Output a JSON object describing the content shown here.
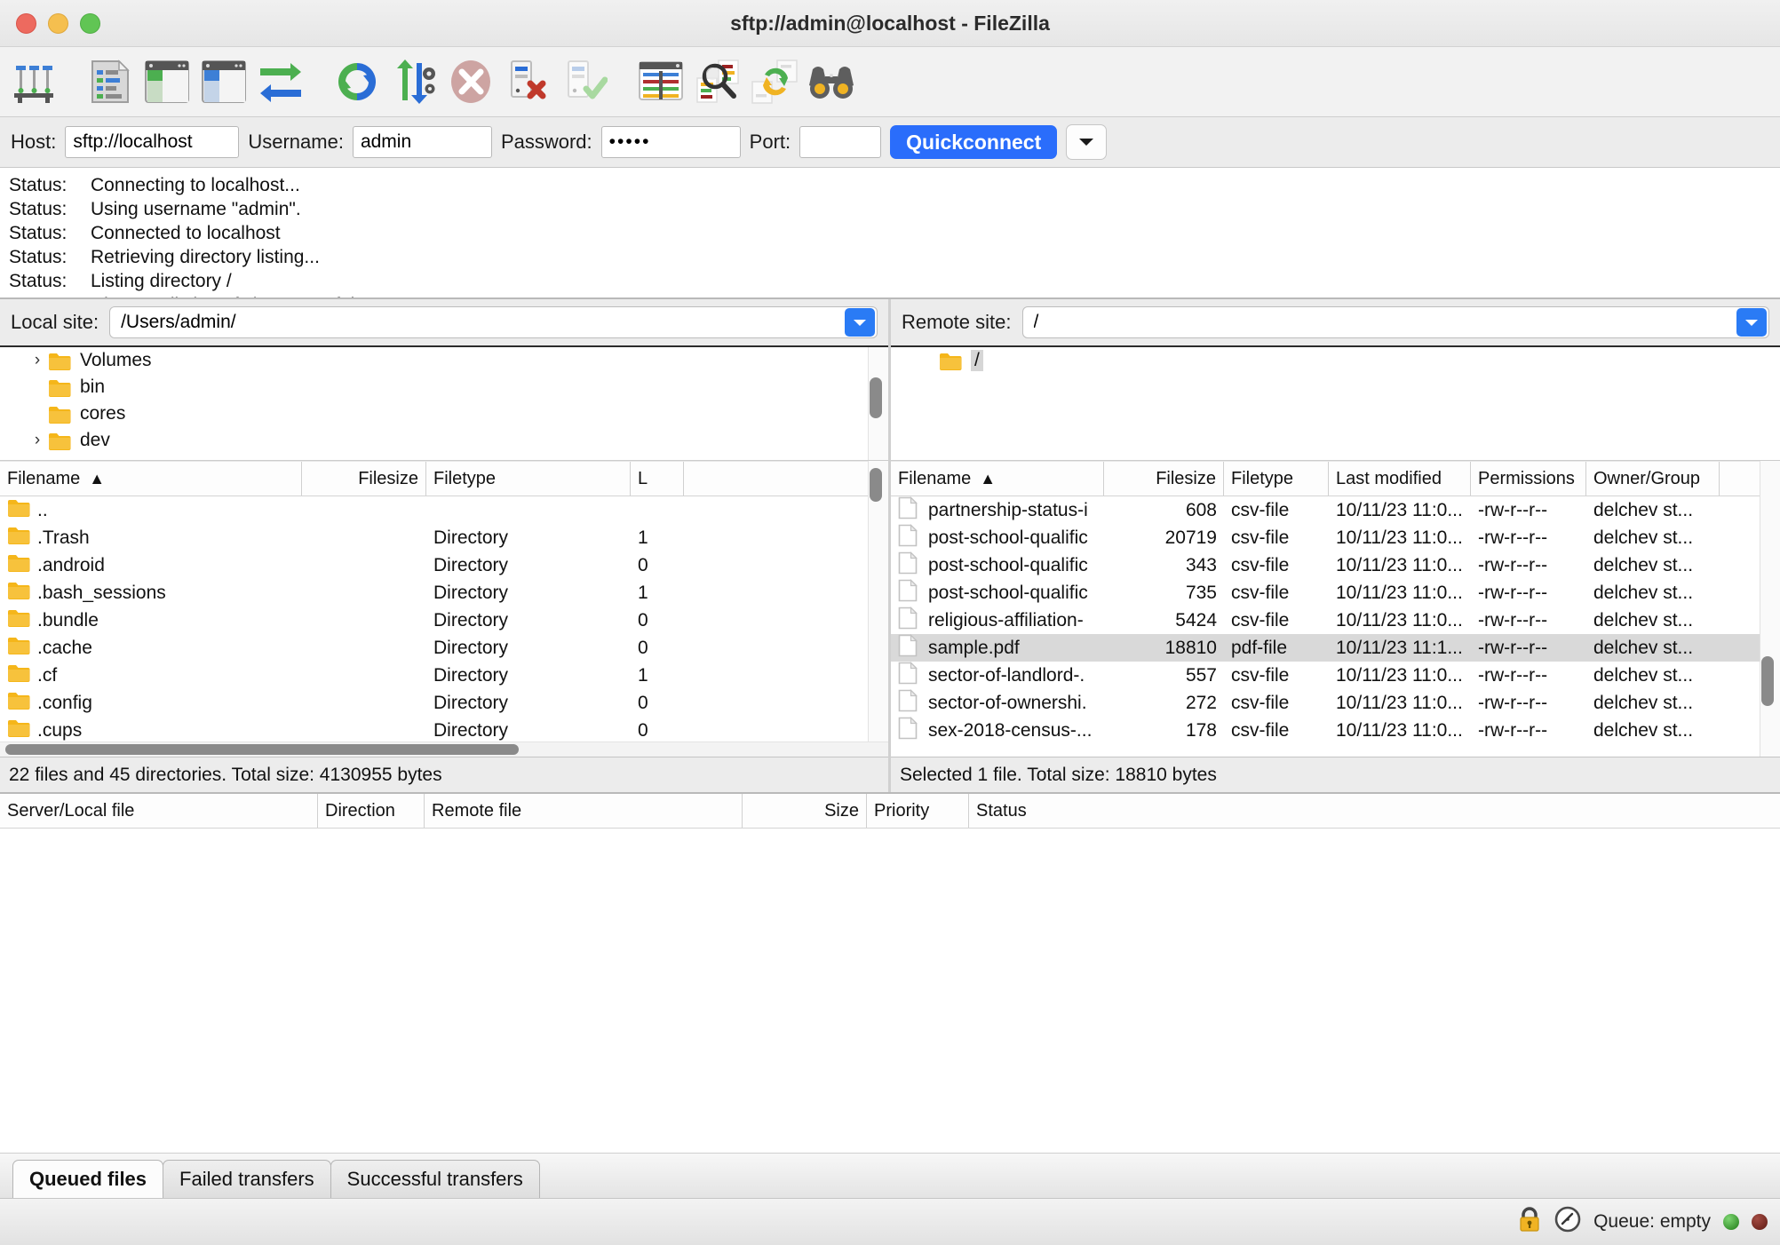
{
  "window": {
    "title": "sftp://admin@localhost - FileZilla",
    "traffic_lights": [
      "close",
      "minimize",
      "maximize"
    ]
  },
  "toolbar": {
    "items": [
      {
        "name": "site-manager-icon",
        "tip": "Open the Site Manager"
      },
      {
        "name": "toggle-message-log-icon",
        "tip": "Toggle message log"
      },
      {
        "name": "toggle-local-tree-icon",
        "tip": "Toggle local directory tree"
      },
      {
        "name": "toggle-remote-tree-icon",
        "tip": "Toggle remote directory tree"
      },
      {
        "name": "toggle-transfer-queue-icon",
        "tip": "Toggle transfer queue"
      },
      {
        "name": "refresh-icon",
        "tip": "Refresh the file and folder lists"
      },
      {
        "name": "process-queue-icon",
        "tip": "Process queue"
      },
      {
        "name": "cancel-icon",
        "tip": "Cancel current operation"
      },
      {
        "name": "disconnect-icon",
        "tip": "Disconnect from server"
      },
      {
        "name": "reconnect-icon",
        "tip": "Reconnect to server"
      },
      {
        "name": "filter-icon",
        "tip": "Open the directory listing filter dialog"
      },
      {
        "name": "compare-directories-icon",
        "tip": "Directory comparison"
      },
      {
        "name": "synchronized-browsing-icon",
        "tip": "Toggle synchronized browsing"
      },
      {
        "name": "find-files-icon",
        "tip": "Search remote files"
      }
    ]
  },
  "quickconnect": {
    "host_label": "Host:",
    "host_value": "sftp://localhost",
    "username_label": "Username:",
    "username_value": "admin",
    "password_label": "Password:",
    "password_value": "•••••",
    "port_label": "Port:",
    "port_value": "",
    "port_placeholder": "",
    "button_label": "Quickconnect",
    "dropdown_icon": "chevron-down-icon",
    "accent_color": "#2a6dfb"
  },
  "log": {
    "entries": [
      {
        "key": "Status:",
        "message": "Connecting to localhost..."
      },
      {
        "key": "Status:",
        "message": "Using username \"admin\"."
      },
      {
        "key": "Status:",
        "message": "Connected to localhost"
      },
      {
        "key": "Status:",
        "message": "Retrieving directory listing..."
      },
      {
        "key": "Status:",
        "message": "Listing directory /"
      },
      {
        "key": "Status:",
        "message": "Directory listing of \"/\" successful"
      }
    ]
  },
  "local": {
    "site_label": "Local site:",
    "site_path": "/Users/admin/",
    "dropdown_icon": "chevron-down-icon",
    "tree": [
      {
        "label": "Volumes",
        "expandable": true,
        "selected": false
      },
      {
        "label": "bin",
        "expandable": false,
        "selected": false
      },
      {
        "label": "cores",
        "expandable": false,
        "selected": false
      },
      {
        "label": "dev",
        "expandable": true,
        "selected": false
      }
    ],
    "columns": [
      {
        "label": "Filename",
        "sorted": true,
        "sort_dir": "asc"
      },
      {
        "label": "Filesize"
      },
      {
        "label": "Filetype"
      },
      {
        "label": "L"
      }
    ],
    "rows": [
      {
        "name": "..",
        "size": "",
        "type": "",
        "last": ""
      },
      {
        "name": ".Trash",
        "size": "",
        "type": "Directory",
        "last": "1"
      },
      {
        "name": ".android",
        "size": "",
        "type": "Directory",
        "last": "0"
      },
      {
        "name": ".bash_sessions",
        "size": "",
        "type": "Directory",
        "last": "1"
      },
      {
        "name": ".bundle",
        "size": "",
        "type": "Directory",
        "last": "0"
      },
      {
        "name": ".cache",
        "size": "",
        "type": "Directory",
        "last": "0"
      },
      {
        "name": ".cf",
        "size": "",
        "type": "Directory",
        "last": "1"
      },
      {
        "name": ".config",
        "size": "",
        "type": "Directory",
        "last": "0"
      },
      {
        "name": ".cups",
        "size": "",
        "type": "Directory",
        "last": "0"
      }
    ],
    "status": "22 files and 45 directories. Total size: 4130955 bytes"
  },
  "remote": {
    "site_label": "Remote site:",
    "site_path": "/",
    "dropdown_icon": "chevron-down-icon",
    "tree": [
      {
        "label": "/",
        "expandable": false,
        "selected": true
      }
    ],
    "columns": [
      {
        "label": "Filename",
        "sorted": true,
        "sort_dir": "asc"
      },
      {
        "label": "Filesize"
      },
      {
        "label": "Filetype"
      },
      {
        "label": "Last modified"
      },
      {
        "label": "Permissions"
      },
      {
        "label": "Owner/Group"
      }
    ],
    "rows": [
      {
        "name": "partnership-status-i",
        "size": "608",
        "type": "csv-file",
        "modified": "10/11/23 11:0...",
        "perms": "-rw-r--r--",
        "owner": "delchev st...",
        "selected": false
      },
      {
        "name": "post-school-qualific",
        "size": "20719",
        "type": "csv-file",
        "modified": "10/11/23 11:0...",
        "perms": "-rw-r--r--",
        "owner": "delchev st...",
        "selected": false
      },
      {
        "name": "post-school-qualific",
        "size": "343",
        "type": "csv-file",
        "modified": "10/11/23 11:0...",
        "perms": "-rw-r--r--",
        "owner": "delchev st...",
        "selected": false
      },
      {
        "name": "post-school-qualific",
        "size": "735",
        "type": "csv-file",
        "modified": "10/11/23 11:0...",
        "perms": "-rw-r--r--",
        "owner": "delchev st...",
        "selected": false
      },
      {
        "name": "religious-affiliation-",
        "size": "5424",
        "type": "csv-file",
        "modified": "10/11/23 11:0...",
        "perms": "-rw-r--r--",
        "owner": "delchev st...",
        "selected": false
      },
      {
        "name": "sample.pdf",
        "size": "18810",
        "type": "pdf-file",
        "modified": "10/11/23 11:1...",
        "perms": "-rw-r--r--",
        "owner": "delchev st...",
        "selected": true
      },
      {
        "name": "sector-of-landlord-.",
        "size": "557",
        "type": "csv-file",
        "modified": "10/11/23 11:0...",
        "perms": "-rw-r--r--",
        "owner": "delchev st...",
        "selected": false
      },
      {
        "name": "sector-of-ownershi.",
        "size": "272",
        "type": "csv-file",
        "modified": "10/11/23 11:0...",
        "perms": "-rw-r--r--",
        "owner": "delchev st...",
        "selected": false
      },
      {
        "name": "sex-2018-census-...",
        "size": "178",
        "type": "csv-file",
        "modified": "10/11/23 11:0...",
        "perms": "-rw-r--r--",
        "owner": "delchev st...",
        "selected": false
      }
    ],
    "status": "Selected 1 file. Total size: 18810 bytes"
  },
  "queue": {
    "columns": [
      "Server/Local file",
      "Direction",
      "Remote file",
      "",
      "Size",
      "Priority",
      "Status"
    ],
    "rows": [],
    "tabs": [
      {
        "label": "Queued files",
        "active": true
      },
      {
        "label": "Failed transfers",
        "active": false
      },
      {
        "label": "Successful transfers",
        "active": false
      }
    ]
  },
  "statusbar": {
    "lock_icon": "lock-icon",
    "speed_icon": "speed-gauge-icon",
    "queue_text": "Queue: empty",
    "indicator_green": "led-green",
    "indicator_red": "led-red"
  }
}
